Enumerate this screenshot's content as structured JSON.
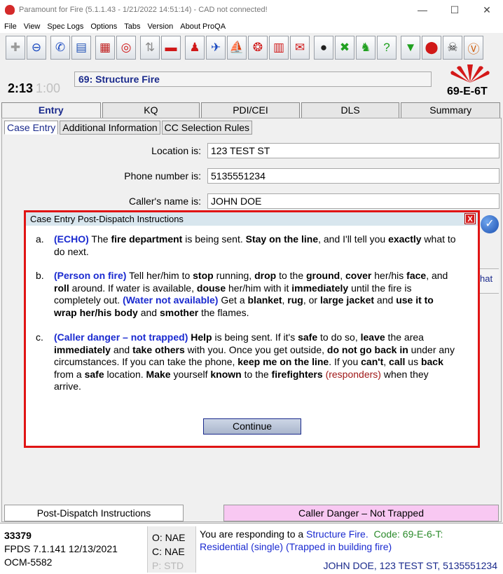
{
  "window": {
    "title": "Paramount for Fire (5.1.1.43 - 1/21/2022 14:51:14) - CAD not connected!"
  },
  "menu": [
    "File",
    "View",
    "Spec Logs",
    "Options",
    "Tabs",
    "Version",
    "About ProQA"
  ],
  "toolbar": {
    "buttons": [
      {
        "name": "add-icon",
        "glyph": "✚",
        "color": "#9a9a9a"
      },
      {
        "name": "minus-icon",
        "glyph": "⊖",
        "color": "#1848c0"
      },
      {
        "name": "phone-icon",
        "glyph": "✆",
        "color": "#1848c0"
      },
      {
        "name": "document-icon",
        "glyph": "▤",
        "color": "#2858b8"
      },
      {
        "name": "checklist-icon",
        "glyph": "▦",
        "color": "#c02020"
      },
      {
        "name": "target-icon",
        "glyph": "◎",
        "color": "#d01818"
      },
      {
        "name": "sort-arrows-icon",
        "glyph": "⇅",
        "color": "#8a8a8a"
      },
      {
        "name": "car-icon",
        "glyph": "▬",
        "color": "#d01818"
      },
      {
        "name": "person-icon",
        "glyph": "♟",
        "color": "#d01818"
      },
      {
        "name": "airplane-icon",
        "glyph": "✈",
        "color": "#1848c0"
      },
      {
        "name": "sailboat-icon",
        "glyph": "⛵",
        "color": "#c020c0"
      },
      {
        "name": "lifebuoy-icon",
        "glyph": "❂",
        "color": "#d01818"
      },
      {
        "name": "train-icon",
        "glyph": "▥",
        "color": "#d01818"
      },
      {
        "name": "mail-icon",
        "glyph": "✉",
        "color": "#d01818"
      },
      {
        "name": "bomb-icon",
        "glyph": "●",
        "color": "#202020"
      },
      {
        "name": "tools-icon",
        "glyph": "✖",
        "color": "#20a020"
      },
      {
        "name": "walking-icon",
        "glyph": "♞",
        "color": "#20a020"
      },
      {
        "name": "help-sign-icon",
        "glyph": "?",
        "color": "#20a020"
      },
      {
        "name": "shirt-icon",
        "glyph": "▼",
        "color": "#20a020"
      },
      {
        "name": "stop-icon",
        "glyph": "⬤",
        "color": "#d01818"
      },
      {
        "name": "hazmat-icon",
        "glyph": "☠",
        "color": "#202020"
      },
      {
        "name": "v-badge-icon",
        "glyph": "Ⓥ",
        "color": "#d06010"
      }
    ]
  },
  "timer": {
    "main": "2:13",
    "secondary": "1:00"
  },
  "incident": {
    "text": "69:  Structure Fire"
  },
  "determinant": "69-E-6T",
  "main_tabs": [
    "Entry",
    "KQ",
    "PDI/CEI",
    "DLS",
    "Summary"
  ],
  "sub_tabs": [
    "Case Entry",
    "Additional Information",
    "CC Selection Rules"
  ],
  "form": {
    "location": {
      "label": "Location is:",
      "value": "123 TEST ST"
    },
    "phone": {
      "label": "Phone number is:",
      "value": "5135551234"
    },
    "caller": {
      "label": "Caller's name is:",
      "value": "JOHN DOE"
    }
  },
  "side_fragment": "hat",
  "dialog": {
    "title": "Case Entry Post-Dispatch Instructions",
    "close": "X",
    "continue_label": "Continue",
    "instructions": [
      {
        "letter": "a.",
        "parts": [
          {
            "t": "(ECHO)",
            "s": "blue"
          },
          {
            "t": " The "
          },
          {
            "t": "fire department",
            "s": "bold"
          },
          {
            "t": " is being sent. "
          },
          {
            "t": "Stay on the line",
            "s": "bold"
          },
          {
            "t": ", and I'll tell you "
          },
          {
            "t": "exactly",
            "s": "bold"
          },
          {
            "t": " what to do next."
          }
        ]
      },
      {
        "letter": "b.",
        "parts": [
          {
            "t": "(Person on fire)",
            "s": "blue"
          },
          {
            "t": " Tell her/him to "
          },
          {
            "t": "stop",
            "s": "bold"
          },
          {
            "t": " running, "
          },
          {
            "t": "drop",
            "s": "bold"
          },
          {
            "t": " to the "
          },
          {
            "t": "ground",
            "s": "bold"
          },
          {
            "t": ", "
          },
          {
            "t": "cover",
            "s": "bold"
          },
          {
            "t": " her/his "
          },
          {
            "t": "face",
            "s": "bold"
          },
          {
            "t": ", and "
          },
          {
            "t": "roll",
            "s": "bold"
          },
          {
            "t": " around. If water is available, "
          },
          {
            "t": "douse",
            "s": "bold"
          },
          {
            "t": " her/him with it "
          },
          {
            "t": "immediately",
            "s": "bold"
          },
          {
            "t": " until the fire is completely out.   "
          },
          {
            "t": "(Water not available)",
            "s": "blue"
          },
          {
            "t": " Get a "
          },
          {
            "t": "blanket",
            "s": "bold"
          },
          {
            "t": ", "
          },
          {
            "t": "rug",
            "s": "bold"
          },
          {
            "t": ", or "
          },
          {
            "t": "large jacket",
            "s": "bold"
          },
          {
            "t": " and "
          },
          {
            "t": "use it to wrap her/his body",
            "s": "bold"
          },
          {
            "t": " and "
          },
          {
            "t": "smother",
            "s": "bold"
          },
          {
            "t": " the flames."
          }
        ]
      },
      {
        "letter": "c.",
        "parts": [
          {
            "t": "(Caller danger – not trapped)",
            "s": "blue"
          },
          {
            "t": " "
          },
          {
            "t": "Help",
            "s": "bold"
          },
          {
            "t": " is being sent. If it's "
          },
          {
            "t": "safe",
            "s": "bold"
          },
          {
            "t": " to do so, "
          },
          {
            "t": "leave",
            "s": "bold"
          },
          {
            "t": " the area "
          },
          {
            "t": "immediately",
            "s": "bold"
          },
          {
            "t": " and "
          },
          {
            "t": "take others",
            "s": "bold"
          },
          {
            "t": " with you. Once you get outside, "
          },
          {
            "t": "do not go back in",
            "s": "bold"
          },
          {
            "t": " under any circumstances. If you can take the phone, "
          },
          {
            "t": "keep me on the line",
            "s": "bold"
          },
          {
            "t": ". If you "
          },
          {
            "t": "can't",
            "s": "bold"
          },
          {
            "t": ", "
          },
          {
            "t": "call",
            "s": "bold"
          },
          {
            "t": " us "
          },
          {
            "t": "back",
            "s": "bold"
          },
          {
            "t": " from a "
          },
          {
            "t": "safe",
            "s": "bold"
          },
          {
            "t": " location. "
          },
          {
            "t": "Make",
            "s": "bold"
          },
          {
            "t": " yourself "
          },
          {
            "t": "known",
            "s": "bold"
          },
          {
            "t": " to the "
          },
          {
            "t": "firefighters",
            "s": "bold"
          },
          {
            "t": " "
          },
          {
            "t": "(responders)",
            "s": "maroon"
          },
          {
            "t": " when they arrive."
          }
        ]
      }
    ]
  },
  "bottom_buttons": {
    "pdi": "Post-Dispatch Instructions",
    "caller_danger": "Caller Danger – Not Trapped"
  },
  "status": {
    "case_number": "33379",
    "fpds": "FPDS  7.1.141  12/13/2021",
    "ocm": "OCM-5582",
    "o": "O: NAE",
    "c": "C: NAE",
    "p": "P: STD",
    "responding_prefix": "You are responding to a ",
    "responding_type": "Structure Fire.",
    "code": "Code: 69-E-6-T:",
    "subtype": "Residential (single) (Trapped in building fire)",
    "caller_line": "JOHN DOE, 123 TEST ST, 5135551234"
  },
  "colors": {
    "accent_blue": "#1a2ad0",
    "dialog_border": "#e01414",
    "caller_danger_bg": "#f8c8f2"
  }
}
